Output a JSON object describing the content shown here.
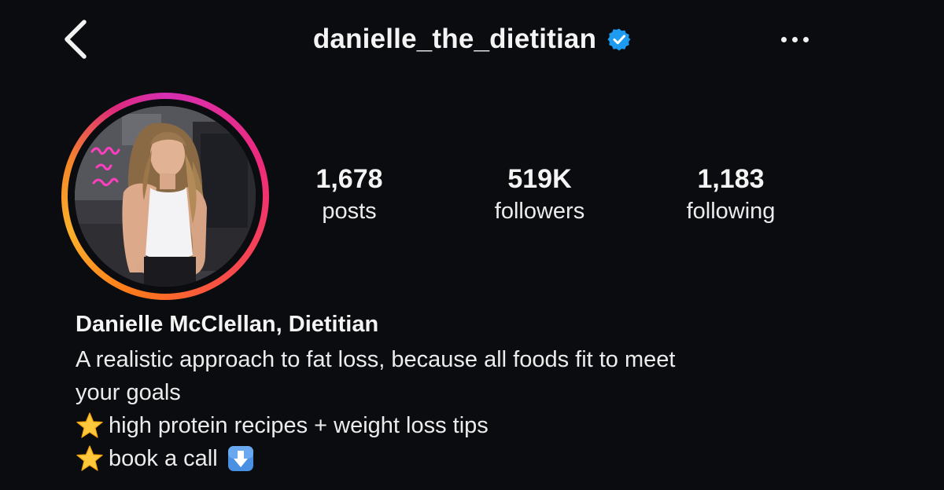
{
  "header": {
    "back_icon": "chevron-left-icon",
    "username": "danielle_the_dietitian",
    "verified_icon": "verified-badge-icon",
    "verified_color": "#1d9bf0",
    "more_icon": "more-horizontal-icon"
  },
  "avatar": {
    "ring_colors": [
      "#d62fb2",
      "#ee2a7b",
      "#f58529",
      "#fbb02a"
    ],
    "neon_sign_color": "#ff3fbf"
  },
  "stats": {
    "posts": {
      "value": "1,678",
      "label": "posts"
    },
    "followers": {
      "value": "519K",
      "label": "followers"
    },
    "following": {
      "value": "1,183",
      "label": "following"
    }
  },
  "profile": {
    "display_name": "Danielle McClellan, Dietitian",
    "bio": {
      "line1": "A realistic approach to fat loss, because all foods fit to meet",
      "line2": "your goals",
      "line3": "high protein recipes + weight loss tips",
      "line4": "book a call",
      "bullet_icon": "star-emoji-icon",
      "cta_icon": "down-arrow-emoji-icon"
    }
  }
}
